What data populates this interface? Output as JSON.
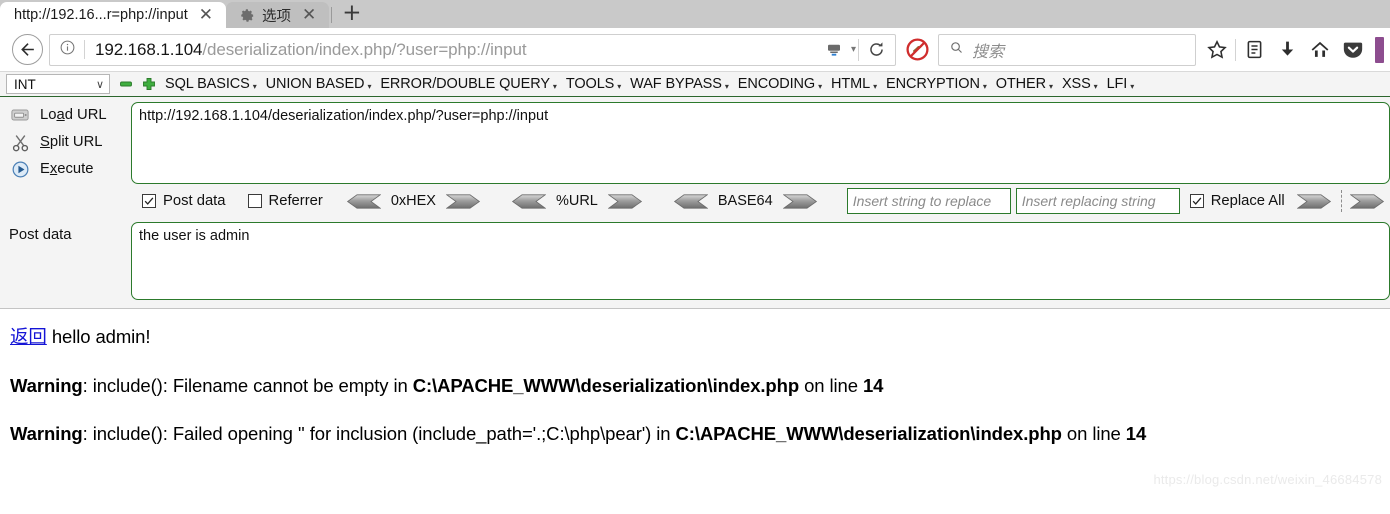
{
  "browser": {
    "tabs": [
      {
        "title": "http://192.16...r=php://input",
        "icon": "page-icon",
        "active": true,
        "close_label": "✕"
      },
      {
        "title": "选项",
        "icon": "gear-icon",
        "active": false,
        "close_label": "✕"
      }
    ],
    "new_tab_label": "+",
    "back_label": "←",
    "url": {
      "domain": "192.168.1.104",
      "path": "/deserialization/index.php/?user=php://input",
      "full": "192.168.1.104/deserialization/index.php/?user=php://input"
    },
    "reader_icon": "reader-view-icon",
    "reader_chevron": "▾",
    "reload_icon": "reload-icon",
    "noscript_icon": "noscript-blocked-icon",
    "search": {
      "placeholder": "搜索",
      "icon": "search-icon"
    },
    "toolbar_icons": [
      {
        "name": "bookmark-star-icon"
      },
      {
        "name": "library-icon"
      },
      {
        "name": "downloads-icon"
      },
      {
        "name": "home-icon"
      },
      {
        "name": "pocket-icon"
      }
    ]
  },
  "hackbar": {
    "type_select": {
      "value": "INT",
      "chevron": "∨"
    },
    "remove_label": "−",
    "add_label": "+",
    "menus": [
      {
        "label": "SQL BASICS",
        "caret": "▾"
      },
      {
        "label": "UNION BASED",
        "caret": "▾"
      },
      {
        "label": "ERROR/DOUBLE QUERY",
        "caret": "▾"
      },
      {
        "label": "TOOLS",
        "caret": "▾"
      },
      {
        "label": "WAF BYPASS",
        "caret": "▾"
      },
      {
        "label": "ENCODING",
        "caret": "▾"
      },
      {
        "label": "HTML",
        "caret": "▾"
      },
      {
        "label": "ENCRYPTION",
        "caret": "▾"
      },
      {
        "label": "OTHER",
        "caret": "▾"
      },
      {
        "label": "XSS",
        "caret": "▾"
      },
      {
        "label": "LFI",
        "caret": "▾"
      }
    ],
    "actions": [
      {
        "label_pre": "Lo",
        "label_key": "a",
        "label_post": "d URL",
        "icon": "load-url-icon"
      },
      {
        "label_pre": "",
        "label_key": "S",
        "label_post": "plit URL",
        "icon": "split-url-scissors-icon"
      },
      {
        "label_pre": "E",
        "label_key": "x",
        "label_post": "ecute",
        "icon": "execute-play-icon"
      }
    ],
    "url_value": "http://192.168.1.104/deserialization/index.php/?user=php://input",
    "checkboxes": [
      {
        "label": "Post data",
        "checked": true
      },
      {
        "label": "Referrer",
        "checked": false
      }
    ],
    "codecs": [
      {
        "label": "0xHEX",
        "decode_icon": "decode-arrow-left-icon",
        "encode_icon": "encode-arrow-right-icon"
      },
      {
        "label": "%URL",
        "decode_icon": "decode-arrow-left-icon",
        "encode_icon": "encode-arrow-right-icon"
      },
      {
        "label": "BASE64",
        "decode_icon": "decode-arrow-left-icon",
        "encode_icon": "encode-arrow-right-icon"
      }
    ],
    "replace": {
      "search_placeholder": "Insert string to replace",
      "replace_placeholder": "Insert replacing string",
      "replace_all_label": "Replace All",
      "replace_all_checked": true
    },
    "post_label": "Post data",
    "post_value": "the user is admin"
  },
  "page": {
    "link_text": "返回",
    "greeting": " hello admin!",
    "warnings": [
      {
        "tag": "Warning",
        "mid": ": include(): Filename cannot be empty in ",
        "file": "C:\\APACHE_WWW\\deserialization\\index.php",
        "tail": " on line ",
        "line": "14"
      },
      {
        "tag": "Warning",
        "mid": ": include(): Failed opening '' for inclusion (include_path='.;C:\\php\\pear') in ",
        "file": "C:\\APACHE_WWW\\deserialization\\index.php",
        "tail": " on line ",
        "line": "14"
      }
    ],
    "watermark": "https://blog.csdn.net/weixin_46684578"
  }
}
